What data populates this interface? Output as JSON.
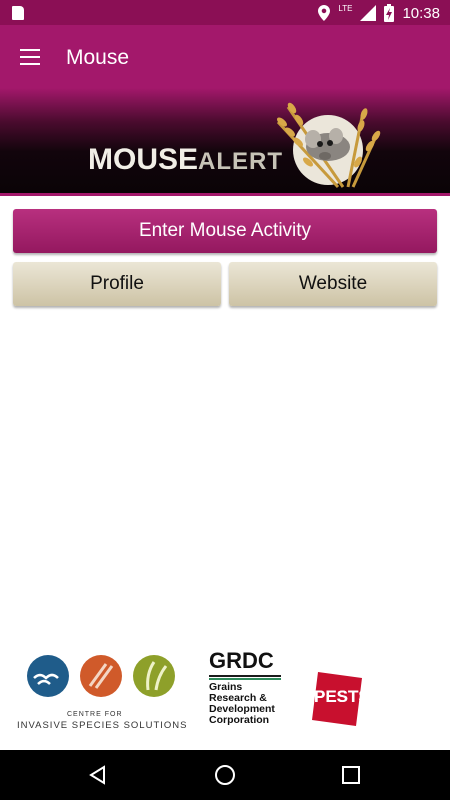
{
  "status_bar": {
    "time": "10:38",
    "network": "LTE",
    "icons": [
      "sd-card-icon",
      "location-icon",
      "signal-icon",
      "battery-charging-icon"
    ]
  },
  "app_bar": {
    "title": "Mouse",
    "menu_icon": "hamburger-menu-icon"
  },
  "banner": {
    "logo_text_main": "MOUSE",
    "logo_text_accent": "ALERT"
  },
  "actions": {
    "enter_activity": "Enter Mouse Activity",
    "profile": "Profile",
    "website": "Website"
  },
  "sponsors": {
    "cis_line1": "CENTRE FOR",
    "cis_line2": "INVASIVE SPECIES SOLUTIONS",
    "grdc_title": "GRDC",
    "grdc_line1": "Grains",
    "grdc_line2": "Research &",
    "grdc_line3": "Development",
    "grdc_line4": "Corporation",
    "pestsmart": "PESTSMART"
  },
  "colors": {
    "primary": "#a3186b",
    "status": "#8b0f55",
    "secondary_button": "#d9d1ba"
  }
}
